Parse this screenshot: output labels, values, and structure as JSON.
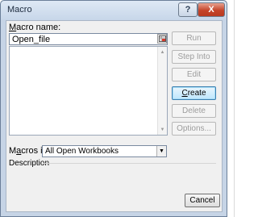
{
  "window": {
    "title": "Macro",
    "help_glyph": "?",
    "close_glyph": "X"
  },
  "macro_name": {
    "label_pre": "",
    "label_u": "M",
    "label_post": "acro name:",
    "value": "Open_file"
  },
  "buttons": {
    "run": "Run",
    "step_into": "Step Into",
    "edit": "Edit",
    "create_u": "C",
    "create_rest": "reate",
    "delete": "Delete",
    "options": "Options..."
  },
  "macros_in": {
    "label_pre": "M",
    "label_u": "a",
    "label_post": "cros in:",
    "selected": "All Open Workbooks"
  },
  "description": {
    "label": "Description"
  },
  "cancel": "Cancel",
  "icons": {
    "refedit": "range-select-icon",
    "dropdown": "chevron-down-icon"
  },
  "colors": {
    "title_bar": "#c7d6e9",
    "close_button": "#c5452b",
    "dialog_bg": "#f0f0f0"
  }
}
